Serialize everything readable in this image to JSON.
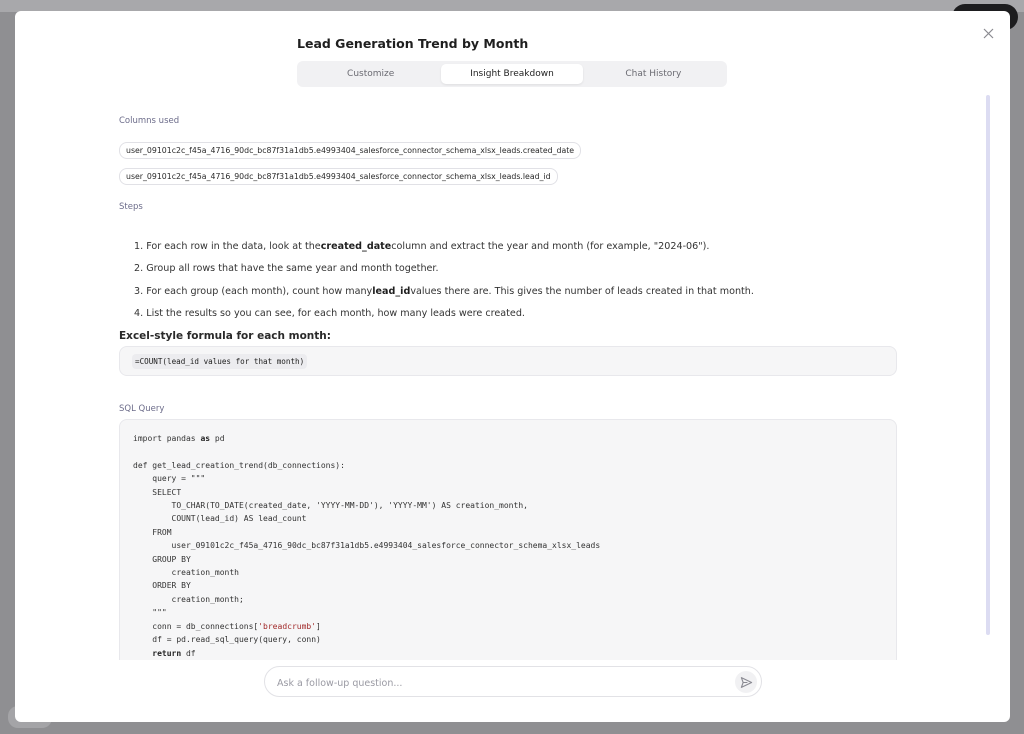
{
  "modal": {
    "title": "Lead Generation Trend by Month",
    "tabs": [
      {
        "label": "Customize"
      },
      {
        "label": "Insight Breakdown",
        "active": true
      },
      {
        "label": "Chat History"
      }
    ]
  },
  "columns": {
    "label": "Columns used",
    "items": [
      "user_09101c2c_f45a_4716_90dc_bc87f31a1db5.e4993404_salesforce_connector_schema_xlsx_leads.created_date",
      "user_09101c2c_f45a_4716_90dc_bc87f31a1db5.e4993404_salesforce_connector_schema_xlsx_leads.lead_id"
    ]
  },
  "steps": {
    "label": "Steps",
    "items": [
      {
        "num": "1.",
        "pre": "For each row in the data, look at the ",
        "bold": "created_date",
        "post": " column and extract the year and month (for example, \"2024-06\")."
      },
      {
        "num": "2.",
        "pre": "Group all rows that have the same year and month together.",
        "bold": "",
        "post": ""
      },
      {
        "num": "3.",
        "pre": "For each group (each month), count how many ",
        "bold": "lead_id",
        "post": " values there are. This gives the number of leads created in that month."
      },
      {
        "num": "4.",
        "pre": "List the results so you can see, for each month, how many leads were created.",
        "bold": "",
        "post": ""
      }
    ]
  },
  "formula": {
    "heading": "Excel-style formula for each month:",
    "code": "=COUNT(lead_id values for that month)"
  },
  "sql": {
    "label": "SQL Query",
    "lines": [
      "import pandas as pd",
      "",
      "def get_lead_creation_trend(db_connections):",
      "    query = \"\"\"",
      "    SELECT",
      "        TO_CHAR(TO_DATE(created_date, 'YYYY-MM-DD'), 'YYYY-MM') AS creation_month,",
      "        COUNT(lead_id) AS lead_count",
      "    FROM",
      "        user_09101c2c_f45a_4716_90dc_bc87f31a1db5.e4993404_salesforce_connector_schema_xlsx_leads",
      "    GROUP BY",
      "        creation_month",
      "    ORDER BY",
      "        creation_month;",
      "    \"\"\"",
      "    conn = db_connections['breadcrumb']",
      "    df = pd.read_sql_query(query, conn)",
      "    return df"
    ]
  },
  "chat": {
    "placeholder": "Ask a follow-up question..."
  },
  "icons": {
    "close": "close-icon",
    "send": "send-icon"
  },
  "colors": {
    "accent_scrollbar": "#dcdcf2",
    "string_literal": "#a12a2a"
  }
}
